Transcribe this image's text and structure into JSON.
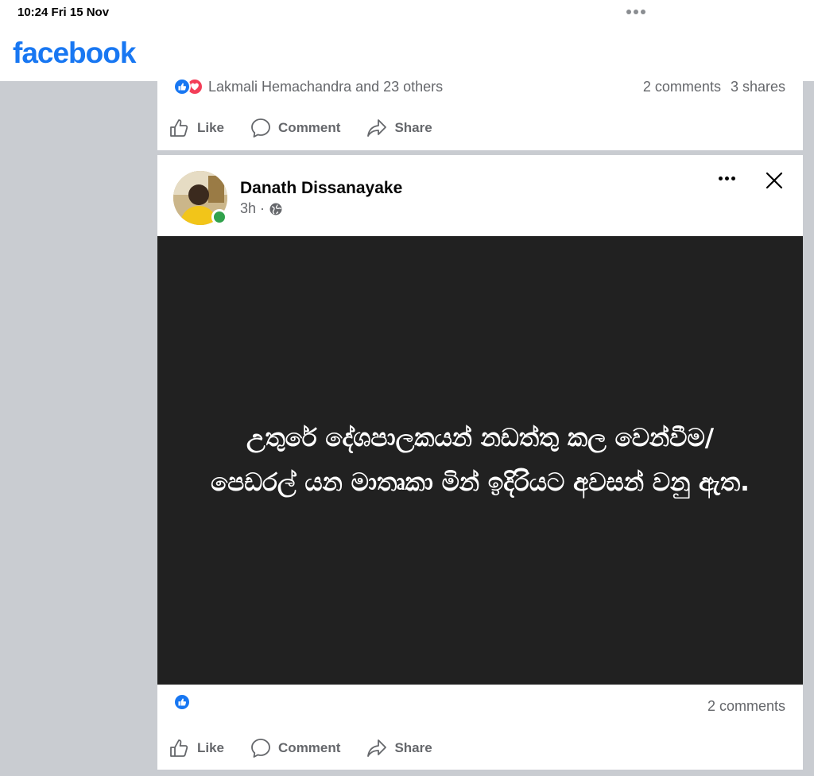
{
  "status_bar": {
    "time": "10:24  Fri 15 Nov"
  },
  "header": {
    "logo": "facebook",
    "brand_color": "#1877f2"
  },
  "prev_post": {
    "reaction_names": "Lakmali Hemachandra and 23 others",
    "comments": "2 comments",
    "shares": "3 shares"
  },
  "actions": {
    "like": "Like",
    "comment": "Comment",
    "share": "Share"
  },
  "post": {
    "author": "Danath Dissanayake",
    "time": "3h ·",
    "text": "උතුරේ දේශපාලකයන් නඩත්තු කල වෙන්වීම/ පෙඩරල් යන මාතෘකා මින් ඉදිරියට අවසන් වනු ඇත.",
    "comments": "2 comments",
    "background_color": "#212121"
  },
  "icons": [
    "like-reaction-icon",
    "love-reaction-icon",
    "thumbs-up-icon",
    "comment-bubble-icon",
    "share-arrow-icon",
    "globe-icon",
    "more-options-icon",
    "close-icon"
  ]
}
